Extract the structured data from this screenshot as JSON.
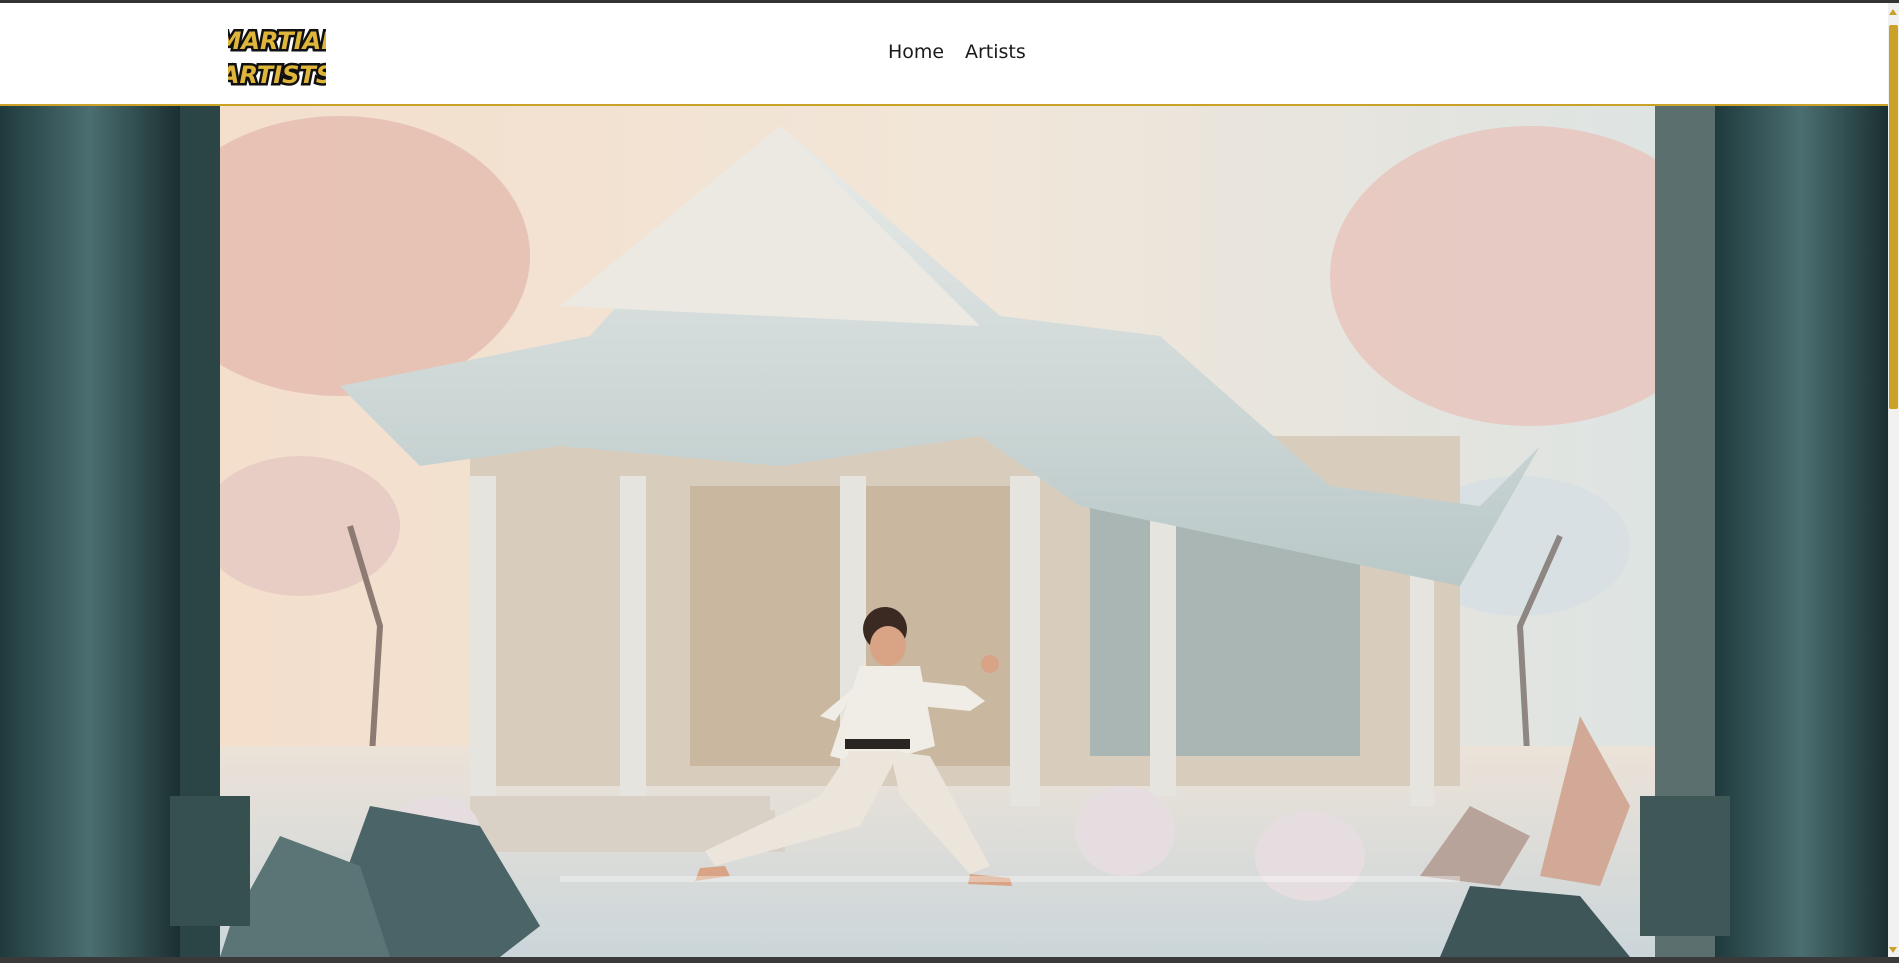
{
  "site": {
    "logo_text": [
      "MARTIAL",
      "ARTISTS"
    ],
    "logo_alt": "Martial Artists logo"
  },
  "nav": {
    "items": [
      {
        "label": "Home"
      },
      {
        "label": "Artists"
      }
    ]
  },
  "hero": {
    "image_alt": "Martial artist in white gi performing a stance in front of a pagoda temple"
  },
  "colors": {
    "accent": "#c9a227",
    "header_bg": "#ffffff",
    "nav_text": "#1a1a1a"
  }
}
